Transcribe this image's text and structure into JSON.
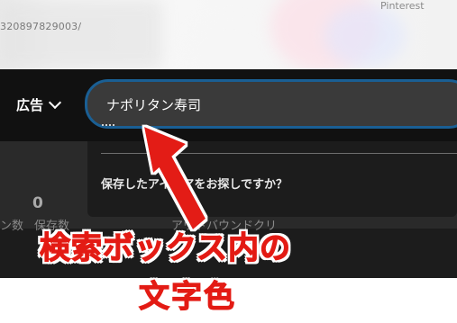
{
  "background": {
    "pin_url_fragment": "320897829003/",
    "brand_text": "Pinterest"
  },
  "header": {
    "ads_menu_label": "広告"
  },
  "search": {
    "value": "ナポリタン寿司",
    "accent_color": "#1a5f94"
  },
  "dropdown": {
    "saved_ideas_prompt": "保存したアイデアをお探しですか？"
  },
  "stats": {
    "value": "0",
    "label_a": "ン数",
    "label_b": "保存数",
    "label_c": "アウトバウンドクリ"
  },
  "annotation": {
    "line1": "検索ボックス内の",
    "line2": "文字色",
    "color": "#e31b14"
  }
}
